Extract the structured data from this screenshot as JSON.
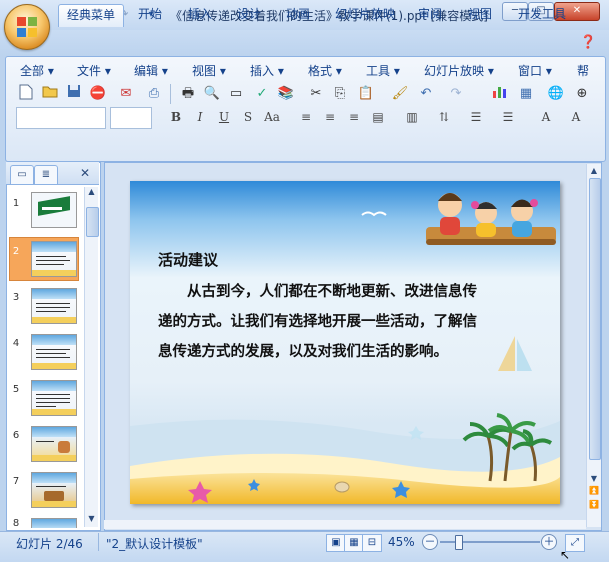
{
  "window": {
    "title": "《信息传递改变着我们的生活》教学课件(1).ppt [兼容模式]",
    "minimize": "─",
    "restore": "□",
    "close": "✕"
  },
  "quick_access": {
    "save_icon": "save-icon",
    "undo_icon": "undo-icon",
    "redo_icon": "redo-icon",
    "customize_icon": "dropdown-icon"
  },
  "ribbon_tabs": [
    "经典菜单",
    "开始",
    "插入",
    "设计",
    "动画",
    "幻灯片放映",
    "审阅",
    "视图",
    "开发工具"
  ],
  "menus": [
    "全部",
    "文件",
    "编辑",
    "视图",
    "插入",
    "格式",
    "工具",
    "幻灯片放映",
    "窗口",
    "帮"
  ],
  "font_buttons": [
    "B",
    "I",
    "U",
    "S",
    "Aa"
  ],
  "slide": {
    "heading": "活动建议",
    "paragraph_lines": [
      "　　从古到今，人们都在不断地更新、改进信息传",
      "递的方式。让我们有选择地开展一些活动，了解信",
      "息传递方式的发展，以及对我们生活的影响。"
    ]
  },
  "thumbnails": {
    "numbers": [
      "1",
      "2",
      "3",
      "4",
      "5",
      "6",
      "7",
      "8"
    ],
    "selected": 2
  },
  "status": {
    "slide_info": "幻灯片 2/46",
    "theme": "\"2_默认设计模板\"",
    "zoom": "45%",
    "zoom_out": "－",
    "zoom_in": "＋"
  },
  "colors": {
    "accent": "#15428b",
    "selected_thumb": "#f6a65a",
    "ribbon": "#dbe7f6"
  }
}
